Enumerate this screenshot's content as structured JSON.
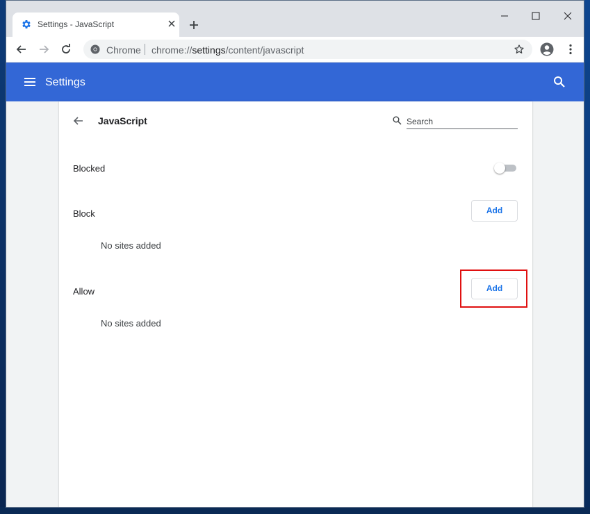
{
  "browser": {
    "tab_title": "Settings - JavaScript",
    "omnibox_label": "Chrome",
    "url_scheme": "chrome://",
    "url_host": "settings",
    "url_path": "/content/javascript"
  },
  "header": {
    "title": "Settings"
  },
  "page": {
    "heading": "JavaScript",
    "search_placeholder": "Search",
    "blocked_label": "Blocked",
    "blocked_toggle_on": false,
    "block_section": {
      "label": "Block",
      "add_label": "Add",
      "empty_text": "No sites added"
    },
    "allow_section": {
      "label": "Allow",
      "add_label": "Add",
      "empty_text": "No sites added"
    }
  },
  "colors": {
    "header_blue": "#3367d6",
    "link_blue": "#1a73e8",
    "highlight_red": "#e01010"
  }
}
